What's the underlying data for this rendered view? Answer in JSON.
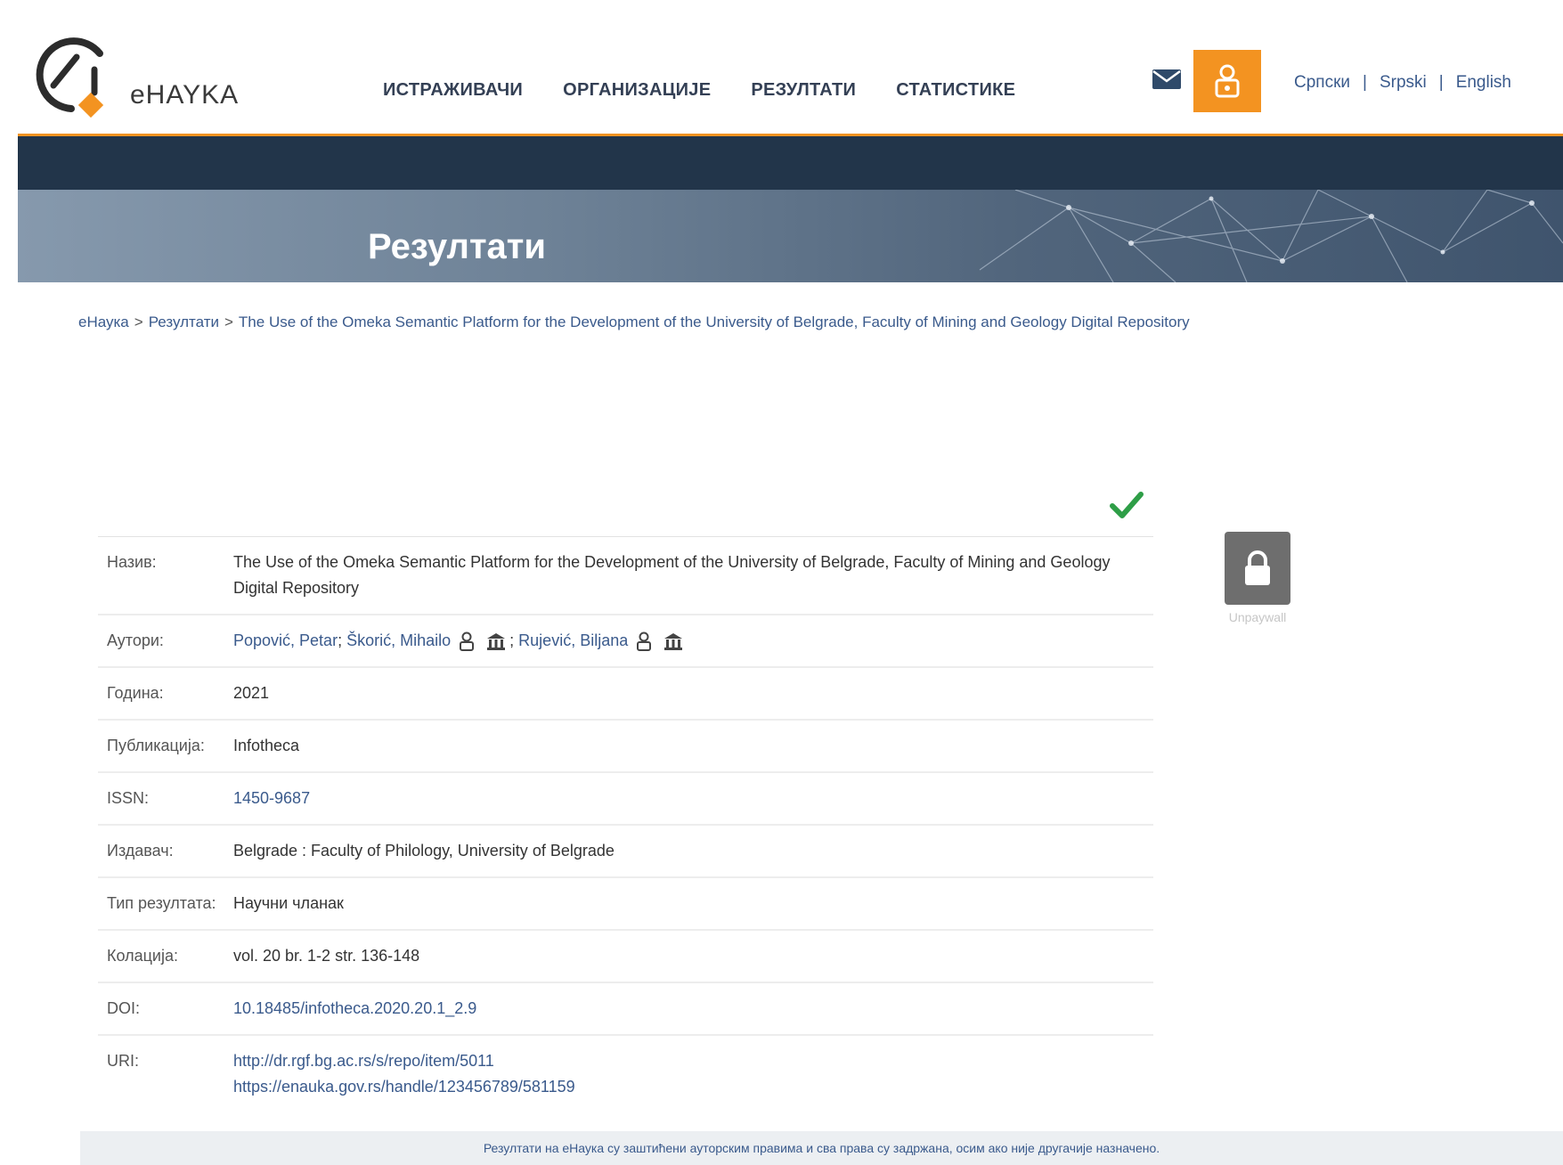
{
  "header": {
    "logo_text": "eHAYKA",
    "nav": [
      "ИСТРАЖИВАЧИ",
      "ОРГАНИЗАЦИЈЕ",
      "РЕЗУЛТАТИ",
      "СТАТИСТИКЕ"
    ],
    "mail_icon": "envelope-icon",
    "login_icon": "user-lock-icon",
    "languages": [
      "Српски",
      "Srpski",
      "English"
    ],
    "accent_color": "#f39321",
    "dark_color": "#22354a"
  },
  "banner": {
    "title": "Резултати"
  },
  "breadcrumb": [
    "eНаука",
    "Резултати",
    "The Use of the Omeka Semantic Platform for the Development of the University of Belgrade, Faculty of Mining and Geology Digital Repository"
  ],
  "record": {
    "rows": [
      {
        "key": "Назив:",
        "value": "The Use of the Omeka Semantic Platform for the Development of the University of Belgrade, Faculty of Mining and Geology Digital Repository"
      },
      {
        "key": "Аутори:",
        "authors": [
          "Popović, Petar",
          "Škorić, Mihailo",
          "Rujević, Biljana"
        ]
      },
      {
        "key": "Година:",
        "value": "2021"
      },
      {
        "key": "Публикација:",
        "value": "Infotheca"
      },
      {
        "key": "ISSN:",
        "value": "1450-9687"
      },
      {
        "key": "Издавач:",
        "value": "Belgrade : Faculty of Philology, University of Belgrade"
      },
      {
        "key": "Тип резултата:",
        "value": "Научни чланак"
      },
      {
        "key": "Колација:",
        "value": "vol. 20 br. 1-2 str. 136-148"
      },
      {
        "key": "DOI:",
        "value": "10.18485/infotheca.2020.20.1_2.9"
      },
      {
        "key": "URI:",
        "links": [
          "http://dr.rgf.bg.ac.rs/s/repo/item/5011",
          "https://enauka.gov.rs/handle/123456789/581159"
        ]
      }
    ]
  },
  "unpaywall": {
    "label": "Unpaywall",
    "icon": "lock-icon"
  },
  "status_icon": "checkmark-icon",
  "footer": {
    "text": "Резултати на eНаука су заштићени ауторским правима и сва права су задржана, осим ако није другачије назначено."
  }
}
